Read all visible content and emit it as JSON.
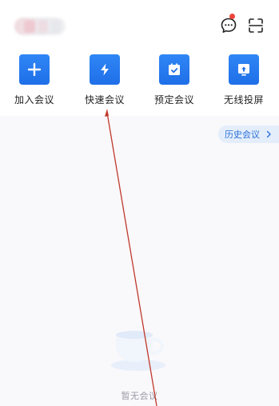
{
  "header": {
    "account_name_blurred": "",
    "message_icon": "message-bubble-icon",
    "scan_icon": "scan-icon",
    "unread_dot_color": "#f0453a"
  },
  "actions": [
    {
      "label": "加入会议",
      "icon": "plus-icon"
    },
    {
      "label": "快速会议",
      "icon": "lightning-icon"
    },
    {
      "label": "预定会议",
      "icon": "calendar-check-icon"
    },
    {
      "label": "无线投屏",
      "icon": "screen-cast-icon"
    }
  ],
  "history_button": {
    "label": "历史会议",
    "icon": "chevron-right-icon"
  },
  "empty_state": {
    "text": "暂无会议",
    "icon": "coffee-cup-icon"
  },
  "colors": {
    "accent": "#1f6fe8",
    "history_bg": "#e4eefb",
    "history_text": "#2a6fd8",
    "content_bg": "#f9f8fb",
    "annotation": "#c0392b"
  }
}
